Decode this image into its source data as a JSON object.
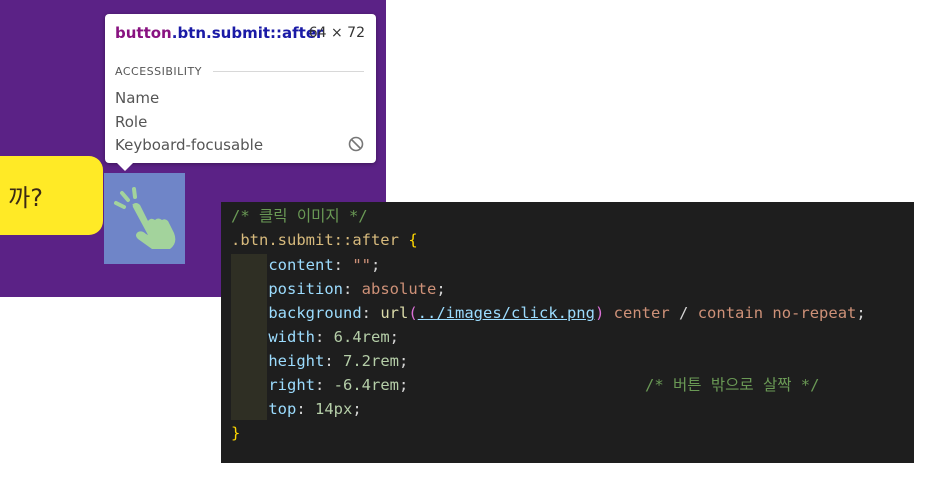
{
  "page": {
    "button_text": "까?"
  },
  "tooltip": {
    "selector_tag": "button",
    "selector_class": ".btn.submit::after",
    "size": "64 × 72",
    "section": "ACCESSIBILITY",
    "rows": [
      "Name",
      "Role",
      "Keyboard-focusable"
    ],
    "keyboard_focusable_icon": "not-allowed-icon"
  },
  "code": {
    "comment_top": "/* 클릭 이미지 */",
    "selector": ".btn.submit::after",
    "open_brace": "{",
    "close_brace": "}",
    "decls": [
      {
        "prop": "content",
        "value": "\"\""
      },
      {
        "prop": "position",
        "value": "absolute"
      },
      {
        "prop": "width",
        "value": "6.4rem"
      },
      {
        "prop": "height",
        "value": "7.2rem"
      },
      {
        "prop": "right",
        "value": "-6.4rem"
      },
      {
        "prop": "top",
        "value": "14px"
      }
    ],
    "background": {
      "prop": "background",
      "fn": "url",
      "url": "../images/click.png",
      "pos": "center",
      "slash": "/",
      "size": "contain",
      "repeat": "no-repeat"
    },
    "right_comment": "/* 버튼 밖으로 살짝 */"
  },
  "colors": {
    "purple": "#5b2286",
    "yellow": "#ffea26",
    "highlight": "#6f85c8",
    "code_bg": "#1e1e1e"
  }
}
